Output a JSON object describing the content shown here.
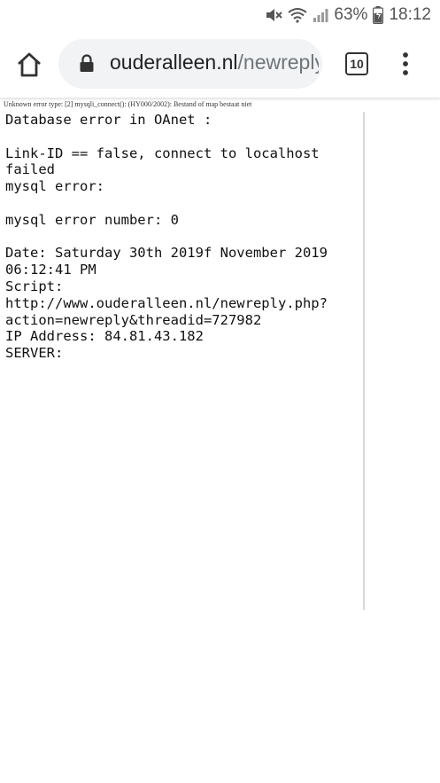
{
  "status_bar": {
    "battery_percent": "63%",
    "time": "18:12",
    "icons": [
      "mute-icon",
      "wifi-icon",
      "signal-icon",
      "battery-icon"
    ]
  },
  "browser": {
    "url_host": "ouderalleen.nl",
    "url_path": "/newreply",
    "tab_count": "10",
    "icons": [
      "home-icon",
      "lock-icon",
      "menu-icon"
    ]
  },
  "page": {
    "notice": "Unknown error type: [2] mysqli_connect(): (HY000/2002): Bestand of map bestaat niet",
    "lines": [
      "Database error in OAnet :",
      "",
      "Link-ID == false, connect to localhost",
      "failed",
      "mysql error:",
      "",
      "mysql error number: 0",
      "",
      "Date: Saturday 30th 2019f November 2019",
      "06:12:41 PM",
      "Script:",
      "http://www.ouderalleen.nl/newreply.php?",
      "action=newreply&threadid=727982",
      "IP Address: 84.81.43.182",
      "SERVER:"
    ]
  }
}
